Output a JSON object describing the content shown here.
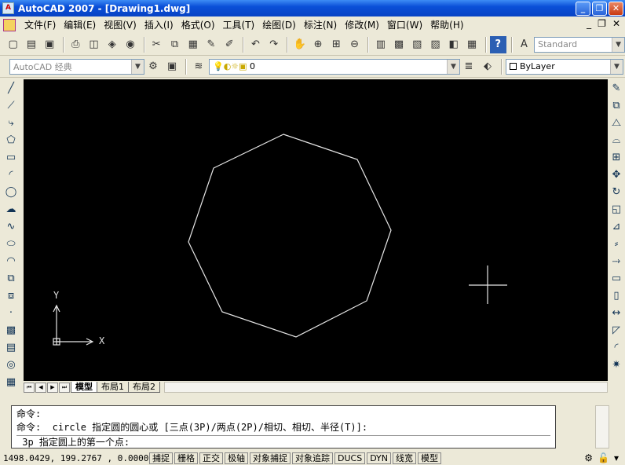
{
  "window": {
    "title": "AutoCAD 2007 - [Drawing1.dwg]",
    "app_icon_text": "A",
    "minimize": "_",
    "maximize": "❐",
    "close": "✕"
  },
  "menubar": {
    "items": [
      "文件(F)",
      "编辑(E)",
      "视图(V)",
      "插入(I)",
      "格式(O)",
      "工具(T)",
      "绘图(D)",
      "标注(N)",
      "修改(M)",
      "窗口(W)",
      "帮助(H)"
    ],
    "mdi_minimize": "_",
    "mdi_restore": "❐",
    "mdi_close": "✕"
  },
  "toolbar1": {
    "text_style_value": "Standard"
  },
  "toolbar2": {
    "workspace_value": "AutoCAD 经典",
    "layer_value": "0",
    "color_value": "ByLayer"
  },
  "icons": {
    "combo_arrow": "▼"
  },
  "canvas": {
    "background": "#000000",
    "line_color": "#e6e6e6",
    "ucs_x_label": "X",
    "ucs_y_label": "Y"
  },
  "layout_tabs": {
    "nav_buttons": [
      "⏮",
      "◀",
      "▶",
      "⏭"
    ],
    "tabs": [
      "模型",
      "布局1",
      "布局2"
    ],
    "active": "模型"
  },
  "command_line": {
    "history": [
      "命令:",
      "命令:  circle 指定圆的圆心或 [三点(3P)/两点(2P)/相切、相切、半径(T)]:"
    ],
    "current": " 3p 指定圆上的第一个点:"
  },
  "statusbar": {
    "coordinates": "1498.0429, 199.2767 , 0.0000",
    "toggles": [
      "捕捉",
      "栅格",
      "正交",
      "极轴",
      "对象捕捉",
      "对象追踪",
      "DUCS",
      "DYN",
      "线宽",
      "模型"
    ]
  }
}
